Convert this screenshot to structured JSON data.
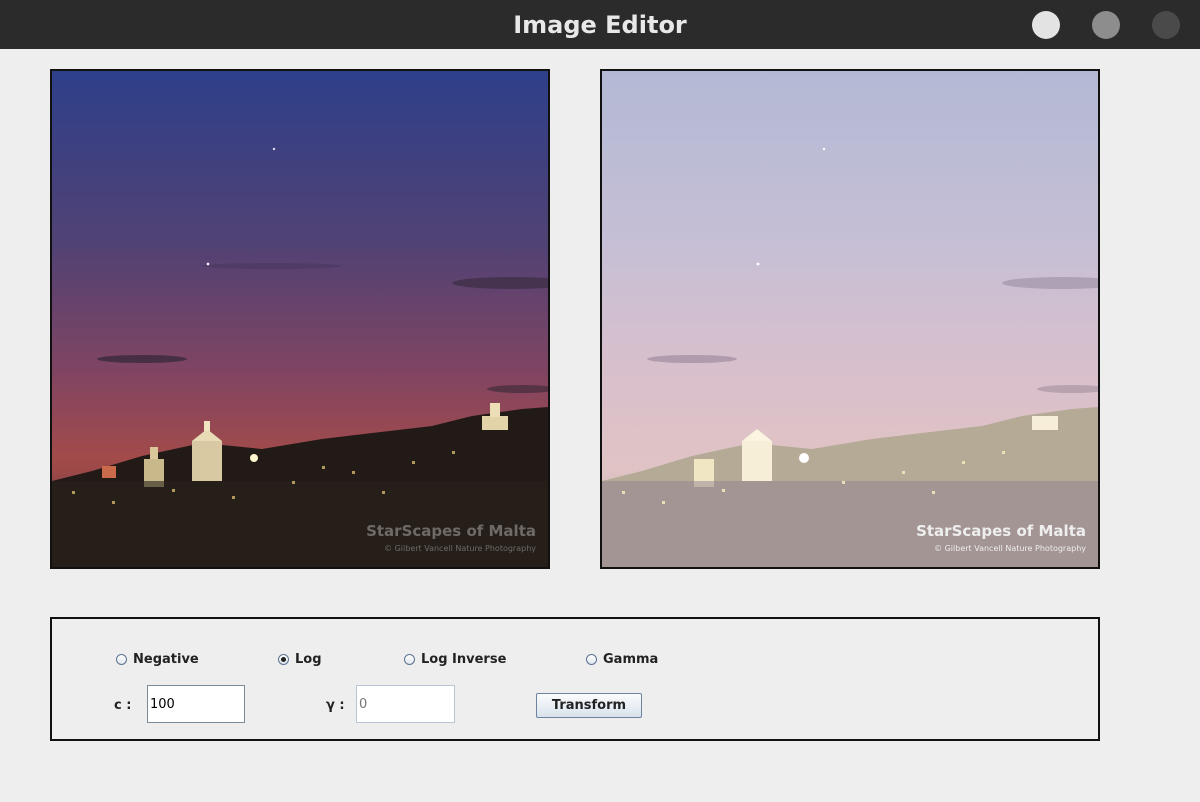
{
  "window": {
    "title": "Image Editor",
    "buttons": [
      {
        "name": "window-minimize-button",
        "color": "#e3e3e3"
      },
      {
        "name": "window-maximize-button",
        "color": "#8d8d8d"
      },
      {
        "name": "window-close-button",
        "color": "#4a4a4a"
      }
    ]
  },
  "images": {
    "original": {
      "watermark_title": "StarScapes of Malta",
      "watermark_credit": "© Gilbert Vancell Nature Photography"
    },
    "transformed": {
      "watermark_title": "StarScapes of Malta",
      "watermark_credit": "© Gilbert Vancell Nature Photography"
    }
  },
  "controls": {
    "options": [
      {
        "label": "Negative",
        "checked": false
      },
      {
        "label": "Log",
        "checked": true
      },
      {
        "label": "Log Inverse",
        "checked": false
      },
      {
        "label": "Gamma",
        "checked": false
      }
    ],
    "c_label": "c :",
    "c_value": "100",
    "gamma_label": "γ :",
    "gamma_placeholder": "0",
    "transform_label": "Transform"
  }
}
